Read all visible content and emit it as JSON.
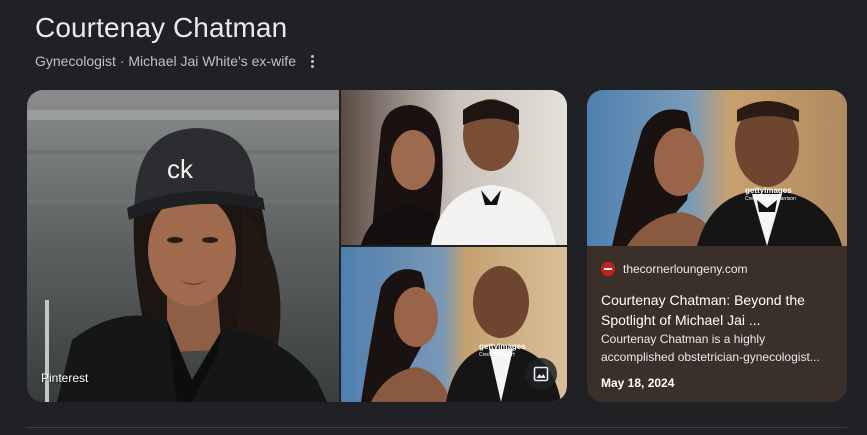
{
  "header": {
    "title": "Courtenay Chatman",
    "subtitle": "Gynecologist · Michael Jai White's ex-wife"
  },
  "gallery": {
    "main_source": "Pinterest",
    "cap_text": "ck",
    "watermark_1": "gettyimages",
    "watermark_2": "gettyimages",
    "watermark_credit": "Credit: Frazer H",
    "icons": {
      "more": "more-vert-icon",
      "images": "image-gallery-icon"
    }
  },
  "card": {
    "site": "thecornerloungeny.com",
    "headline": "Courtenay Chatman: Beyond the Spotlight of Michael Jai ...",
    "snippet": "Courtenay Chatman is a highly accomplished obstetrician-gynecologist...",
    "date": "May 18, 2024",
    "watermark": "gettyimages",
    "watermark_credit": "Credit: Frazer Harrison"
  },
  "colors": {
    "background": "#202124",
    "card_background": "#3b2f2a",
    "text_primary": "#e8eaed",
    "text_secondary": "#bdc1c6",
    "favicon": "#c5221f"
  }
}
